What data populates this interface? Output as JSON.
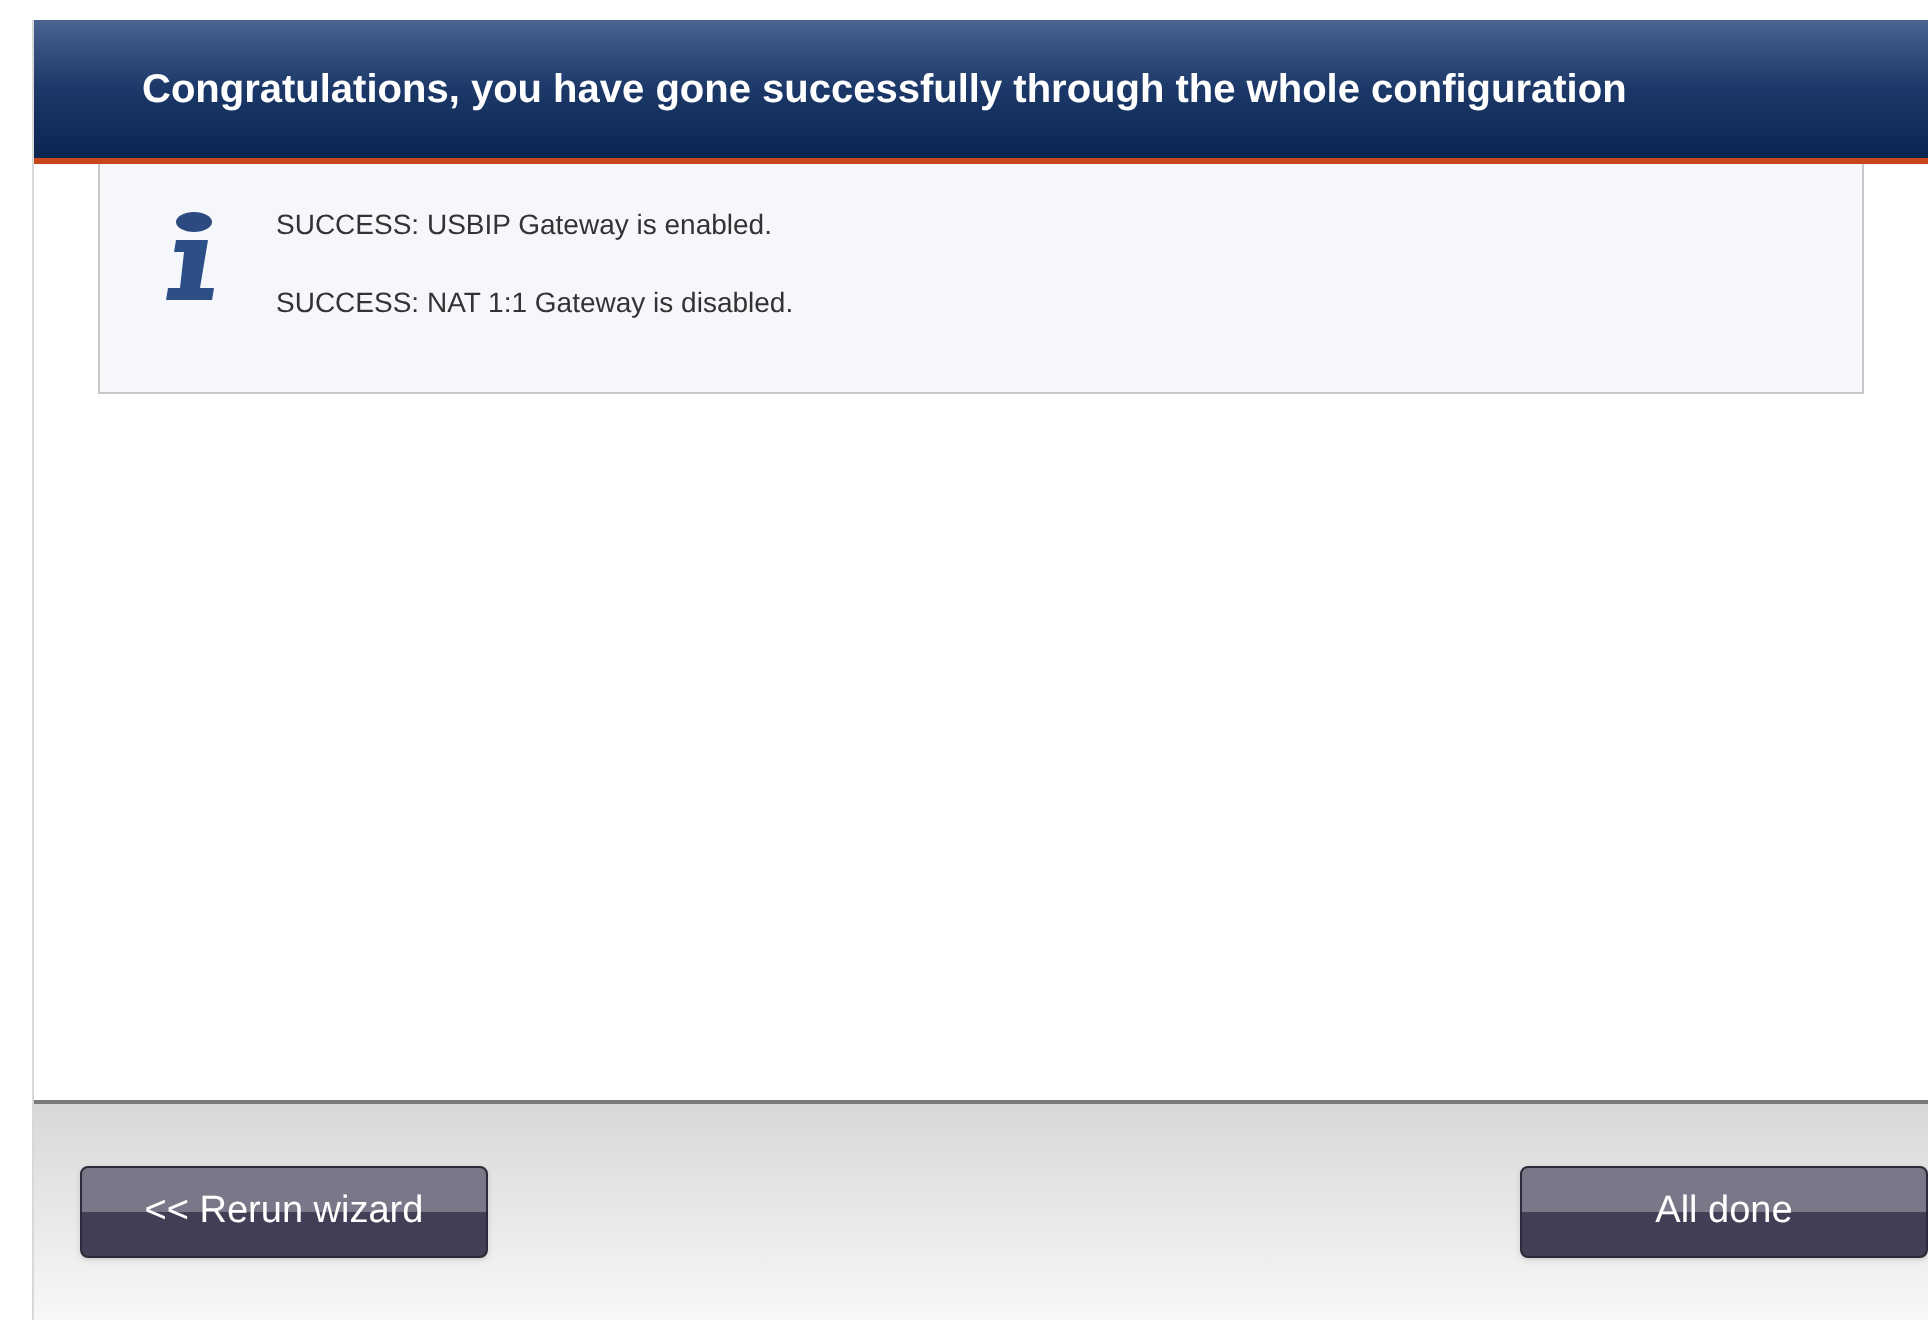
{
  "dialog": {
    "title": "Congratulations, you have gone successfully through the whole configuration"
  },
  "messages": [
    "SUCCESS: USBIP Gateway is enabled.",
    "SUCCESS: NAT 1:1 Gateway is disabled."
  ],
  "buttons": [
    {
      "label": "<< Rerun wizard"
    },
    {
      "label": "All done"
    }
  ]
}
